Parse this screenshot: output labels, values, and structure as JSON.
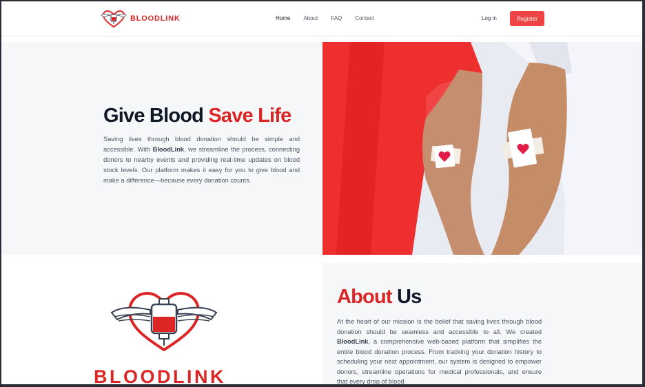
{
  "brand": {
    "name": "BLOODLINK",
    "color": "#dc2626",
    "logo_icon": "heart-blood-bag-wings-icon"
  },
  "nav": {
    "links": [
      "Home",
      "About",
      "FAQ",
      "Contact"
    ],
    "active": "Home",
    "login_label": "Log in",
    "register_label": "Register"
  },
  "hero": {
    "title_dark": "Give Blood ",
    "title_red": "Save Life",
    "text_before": "Saving lives through blood donation should be simple and accessible. With ",
    "text_brand": "BloodLink",
    "text_after": ", we streamline the process, connecting donors to nearby events and providing real-time updates on blood stock levels. Our platform makes it easy for you to give blood and make a difference—because every donation counts.",
    "image_icon": "donor-arms-photo"
  },
  "about": {
    "logo_text": "BLOODLINK",
    "title_red": "About",
    "title_dark": " Us",
    "text_before": "At the heart of our mission is the belief that saving lives through blood donation should be seamless and accessible to all. We created ",
    "text_brand": "BloodLink",
    "text_after": ", a comprehensive web-based platform that simplifies the entire blood donation process. From tracking your donation history to scheduling your next appointment, our system is designed to empower donors, streamline operations for medical professionals, and ensure that every drop of blood"
  },
  "colors": {
    "accent": "#ef4444",
    "text_dark": "#111827",
    "text_body": "#4b5563",
    "section_bg": "#f6f7f9"
  }
}
